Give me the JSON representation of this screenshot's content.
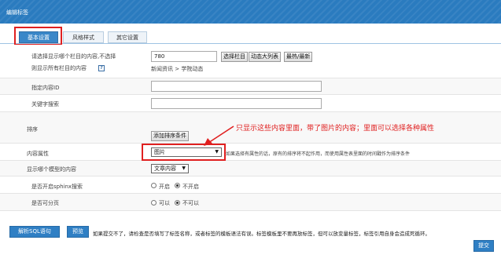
{
  "window": {
    "title": "编辑标签"
  },
  "tabs": [
    {
      "label": "基本设置",
      "active": true
    },
    {
      "label": "风格样式",
      "active": false
    },
    {
      "label": "其它设置",
      "active": false
    }
  ],
  "form": {
    "column_select": {
      "label_line1": "请选择显示哪个栏目的内容,不选择",
      "label_line2": "则显示所有栏目的内容",
      "help": "?",
      "value": "780",
      "buttons": {
        "select_column": "选择栏目",
        "dynamic_list": "动态大列表",
        "hot_latest": "最热/最新"
      },
      "path": "新闻资讯 > 学院动态"
    },
    "content_id": {
      "label": "指定内容ID",
      "value": ""
    },
    "keywords": {
      "label": "关键字搜索",
      "value": ""
    },
    "sort": {
      "label": "排序",
      "add_button": "添加排序条件"
    },
    "attribute": {
      "label": "内容属性",
      "selected": "图片",
      "arrow": "▼",
      "note": "如果选择有属性的话，原有的排序将不起作用，而使用属性表里面的时间戳作为排序条件"
    },
    "annotation": "只显示这些内容里面，带了图片的内容；里面可以选择各种属性",
    "model": {
      "label": "显示哪个模型的内容",
      "selected": "文章内容",
      "arrow": "▼"
    },
    "sphinx": {
      "label": "是否开启sphinx搜索",
      "options": [
        "开启",
        "不开启"
      ],
      "selected_index": 1
    },
    "paging": {
      "label": "是否可分页",
      "options": [
        "可以",
        "不可以"
      ],
      "selected_index": 1
    }
  },
  "footer": {
    "parse_sql": "解析SQL语句",
    "preview": "预览",
    "message": "如果提交不了，请检查是否填写了标签名称，或者标签的模板语法有误。标签模板里不要再放标签，但可以放变量标签，标签引用自身会造成死循环。",
    "submit": "提交"
  },
  "colors": {
    "header": "#2a7bbf",
    "accent_red": "#e02020",
    "button_blue": "#2f7fc4"
  }
}
